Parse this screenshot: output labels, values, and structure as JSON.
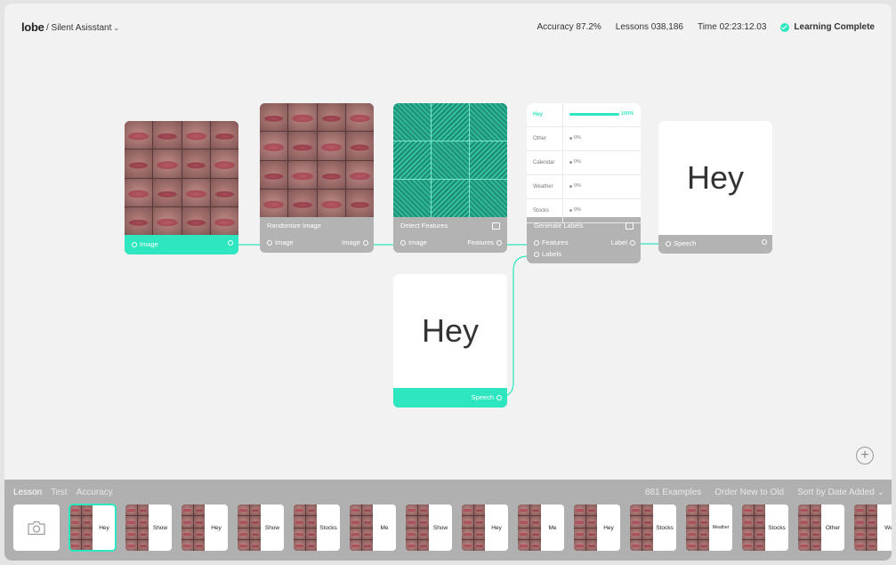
{
  "header": {
    "logo": "lobe",
    "project": "/ Silent Asisstant",
    "accuracy": "Accuracy 87.2%",
    "lessons": "Lessons 038,186",
    "time": "Time 02:23:12.03",
    "status": "Learning Complete"
  },
  "colors": {
    "accent": "#2ee6bf",
    "node_footer": "#b3b3b3",
    "panel": "#b0b0b0",
    "background": "#f2f2f2"
  },
  "nodes": {
    "image": {
      "output": "Image"
    },
    "randomize": {
      "title": "Randomize Image",
      "input": "Image",
      "output": "Image"
    },
    "detect": {
      "title": "Detect Features",
      "input": "Image",
      "output": "Features"
    },
    "generate": {
      "title": "Generate Labels",
      "input1": "Features",
      "input2": "Labels",
      "output": "Label",
      "rows": [
        {
          "name": "Hey",
          "pct": "100%",
          "value": 1.0
        },
        {
          "name": "Other",
          "pct": "0%",
          "value": 0
        },
        {
          "name": "Calendar",
          "pct": "0%",
          "value": 0
        },
        {
          "name": "Weather",
          "pct": "0%",
          "value": 0
        },
        {
          "name": "Stocks",
          "pct": "0%",
          "value": 0
        }
      ]
    },
    "speech_out": {
      "word": "Hey",
      "input": "Speech"
    },
    "speech_in": {
      "word": "Hey",
      "output": "Speech"
    }
  },
  "bottom": {
    "tabs": [
      "Lesson",
      "Test",
      "Accuracy"
    ],
    "examples": "881 Examples",
    "order": "Order New to Old",
    "sort": "Sort by Date Added",
    "sort_chevron": "⌄",
    "add_icon": "+",
    "thumbs": [
      "Hey",
      "Show",
      "Hey",
      "Show",
      "Stocks",
      "Me",
      "Show",
      "Hey",
      "Me",
      "Hey",
      "Stocks",
      "Weather",
      "Stocks",
      "Other",
      "We"
    ]
  },
  "icons": {
    "camera": "camera-icon",
    "add": "plus-circle-icon",
    "check": "check-circle-icon",
    "chevron": "chevron-down-icon"
  }
}
